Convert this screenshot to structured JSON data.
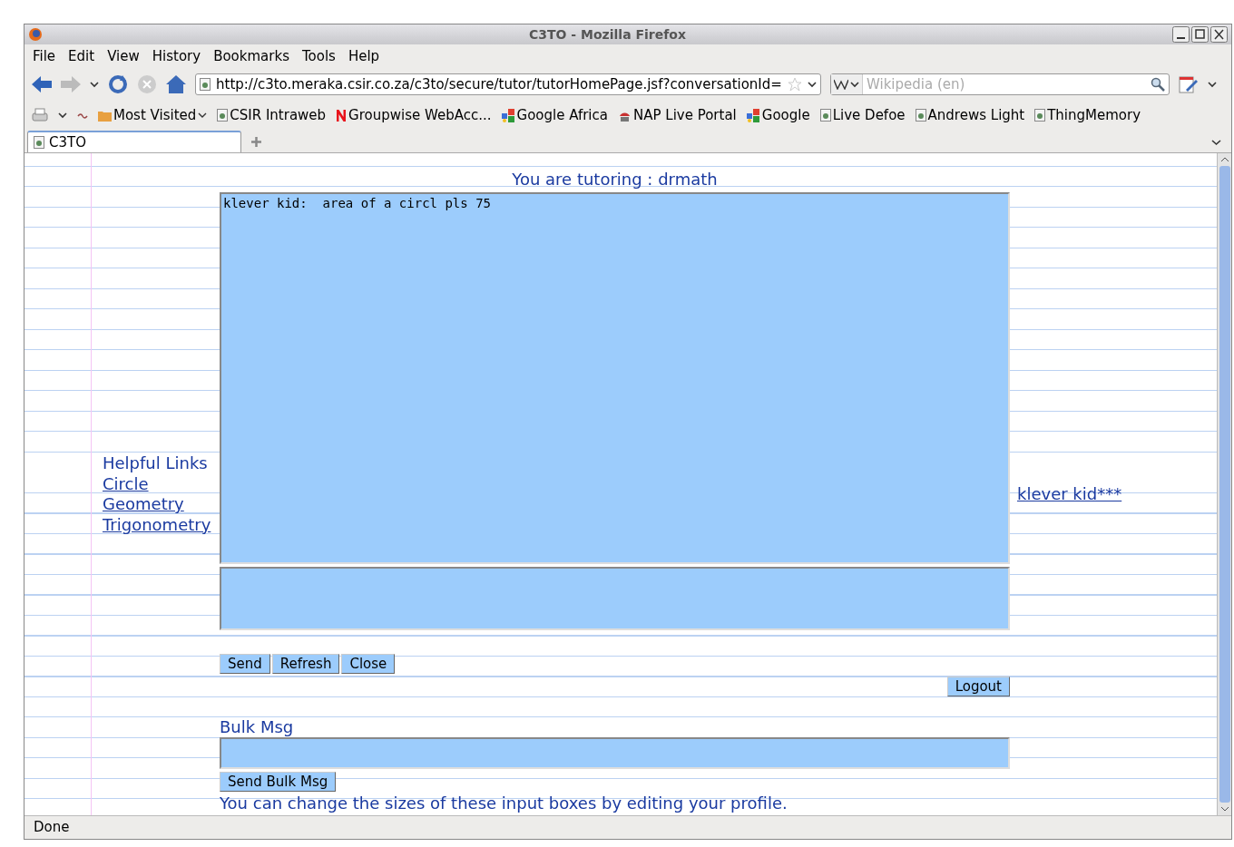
{
  "window": {
    "title": "C3TO - Mozilla Firefox"
  },
  "menu": [
    "File",
    "Edit",
    "View",
    "History",
    "Bookmarks",
    "Tools",
    "Help"
  ],
  "navbar": {
    "url": "http://c3to.meraka.csir.co.za/c3to/secure/tutor/tutorHomePage.jsf?conversationId=",
    "search_placeholder": "Wikipedia (en)"
  },
  "bookmarks": [
    {
      "label": "Most Visited",
      "kind": "folder"
    },
    {
      "label": "CSIR Intraweb",
      "kind": "page"
    },
    {
      "label": "Groupwise WebAcc...",
      "kind": "novell"
    },
    {
      "label": "Google Africa",
      "kind": "google"
    },
    {
      "label": "NAP Live Portal",
      "kind": "nap"
    },
    {
      "label": "Google",
      "kind": "google"
    },
    {
      "label": "Live Defoe",
      "kind": "page"
    },
    {
      "label": "Andrews Light",
      "kind": "page"
    },
    {
      "label": "ThingMemory",
      "kind": "page"
    }
  ],
  "tabs": [
    {
      "label": "C3TO",
      "selected": true
    }
  ],
  "page": {
    "heading": "You are tutoring : drmath",
    "chat_log": "klever kid:  area of a circl pls 75",
    "links_heading": "Helpful Links",
    "links": [
      "Circle",
      "Geometry",
      "Trigonometry"
    ],
    "student_link": "klever kid***",
    "buttons": [
      "Send",
      "Refresh",
      "Close"
    ],
    "logout": "Logout",
    "bulk_label": "Bulk Msg",
    "bulk_button": "Send Bulk Msg",
    "note": "You can change the sizes of these input boxes by editing your profile."
  },
  "status_bar": "Done"
}
